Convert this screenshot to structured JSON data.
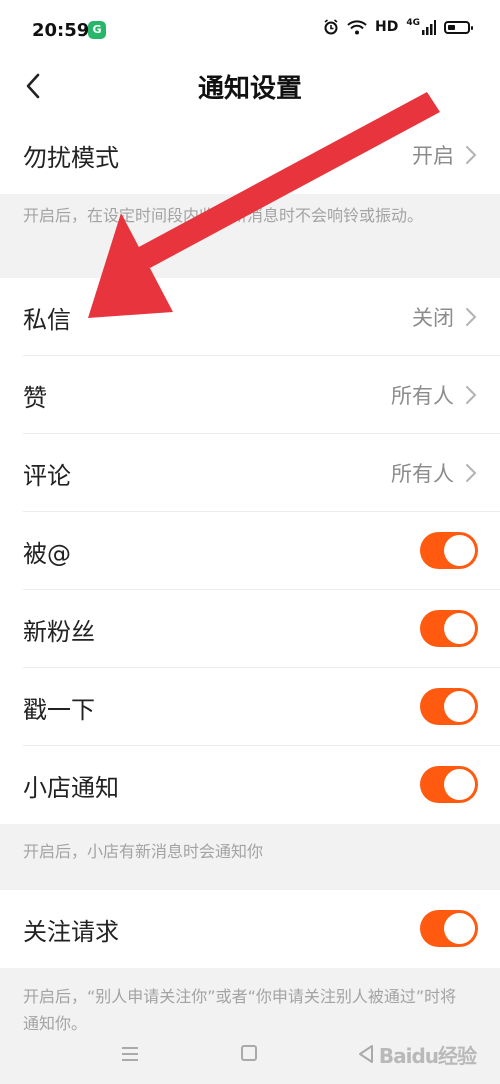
{
  "status_bar": {
    "time": "20:59",
    "app_badge": "G",
    "hd": "HD",
    "network": "4G"
  },
  "header": {
    "title": "通知设置"
  },
  "dnd": {
    "label": "勿扰模式",
    "value": "开启",
    "note": "开启后，在设定时间段内收到新消息时不会响铃或振动。"
  },
  "rows": {
    "private_message": {
      "label": "私信",
      "value": "关闭"
    },
    "likes": {
      "label": "赞",
      "value": "所有人"
    },
    "comments": {
      "label": "评论",
      "value": "所有人"
    },
    "mentions": {
      "label": "被@",
      "enabled": true
    },
    "new_fans": {
      "label": "新粉丝",
      "enabled": true
    },
    "poke": {
      "label": "戳一下",
      "enabled": true
    },
    "shop": {
      "label": "小店通知",
      "enabled": true
    }
  },
  "shop_note": "开启后，小店有新消息时会通知你",
  "follow_request": {
    "label": "关注请求",
    "enabled": true,
    "note": "开启后，“别人申请关注你”或者“你申请关注别人被通过”时将通知你。"
  },
  "watermark": "Baidu经验",
  "colors": {
    "accent": "#ff5a0f",
    "annotation_arrow": "#e8343c"
  }
}
